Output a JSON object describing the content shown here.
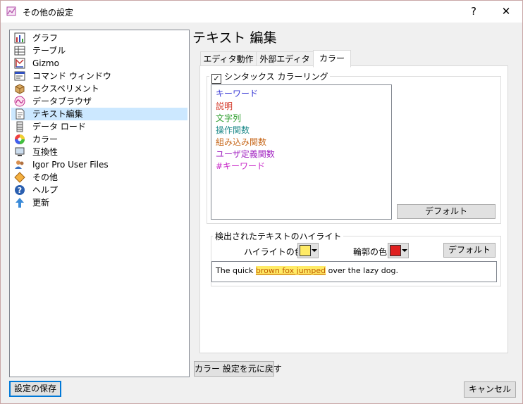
{
  "window": {
    "title": "その他の設定",
    "help_glyph": "?",
    "close_glyph": "✕"
  },
  "sidebar": {
    "items": [
      {
        "label": "グラフ",
        "icon": "graph-icon"
      },
      {
        "label": "テーブル",
        "icon": "table-icon"
      },
      {
        "label": "Gizmo",
        "icon": "gizmo-icon"
      },
      {
        "label": "コマンド ウィンドウ",
        "icon": "command-window-icon"
      },
      {
        "label": "エクスペリメント",
        "icon": "experiment-icon"
      },
      {
        "label": "データブラウザ",
        "icon": "data-browser-icon"
      },
      {
        "label": "テキスト編集",
        "icon": "text-edit-icon",
        "selected": true
      },
      {
        "label": "データ ロード",
        "icon": "data-load-icon"
      },
      {
        "label": "カラー",
        "icon": "color-icon"
      },
      {
        "label": "互換性",
        "icon": "compatibility-icon"
      },
      {
        "label": "Igor Pro User Files",
        "icon": "user-files-icon"
      },
      {
        "label": "その他",
        "icon": "misc-icon"
      },
      {
        "label": "ヘルプ",
        "icon": "help-icon"
      },
      {
        "label": "更新",
        "icon": "update-icon"
      }
    ]
  },
  "main": {
    "title": "テキスト 編集",
    "tabs": [
      {
        "label": "エディタ動作"
      },
      {
        "label": "外部エディタ"
      },
      {
        "label": "カラー",
        "active": true
      }
    ],
    "syntax_group": {
      "checkbox_label": "シンタックス カラーリング",
      "checked": true,
      "check_glyph": "✓",
      "items": [
        {
          "label": "キーワード",
          "color": "#3b3bd6"
        },
        {
          "label": "説明",
          "color": "#d43a2a"
        },
        {
          "label": "文字列",
          "color": "#2e9e2e"
        },
        {
          "label": "操作関数",
          "color": "#1f8a8a"
        },
        {
          "label": "組み込み関数",
          "color": "#c86a1e"
        },
        {
          "label": "ユーザ定義関数",
          "color": "#a020c0"
        },
        {
          "label": "#キーワード",
          "color": "#c828c8"
        }
      ],
      "default_button": "デフォルト"
    },
    "highlight_group": {
      "title": "検出されたテキストのハイライト",
      "highlight_color_label": "ハイライトの色",
      "highlight_color": "#ffeb66",
      "outline_color_label": "輪郭の色",
      "outline_color": "#e02020",
      "default_button": "デフォルト",
      "sample_before": "The quick ",
      "sample_highlight": "brown fox jumped",
      "sample_after": " over the lazy dog."
    },
    "reset_button": "カラー 設定を元に戻す"
  },
  "footer": {
    "save_button": "設定の保存",
    "cancel_button": "キャンセル"
  }
}
